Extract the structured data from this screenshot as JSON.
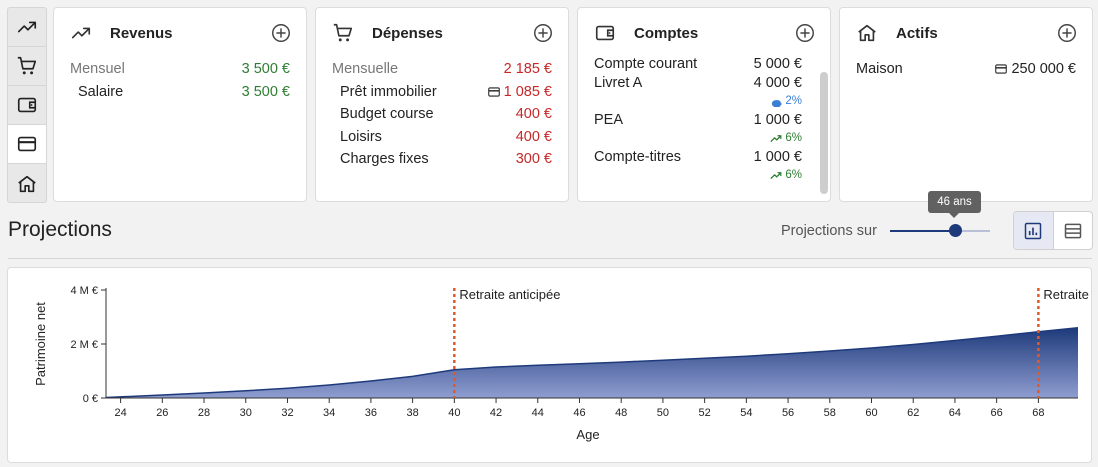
{
  "rail": {
    "items": [
      {
        "name": "trending-up-icon",
        "active": false
      },
      {
        "name": "cart-icon",
        "active": false
      },
      {
        "name": "wallet-icon",
        "active": false
      },
      {
        "name": "credit-card-icon",
        "active": true
      },
      {
        "name": "home-icon",
        "active": false
      }
    ]
  },
  "revenus": {
    "title": "Revenus",
    "group_label": "Mensuel",
    "group_amount": "3 500 €",
    "items": [
      {
        "label": "Salaire",
        "amount": "3 500 €"
      }
    ]
  },
  "depenses": {
    "title": "Dépenses",
    "group_label": "Mensuelle",
    "group_amount": "2 185 €",
    "items": [
      {
        "label": "Prêt immobilier",
        "amount": "1 085 €",
        "icon": "credit-card-icon"
      },
      {
        "label": "Budget course",
        "amount": "400 €"
      },
      {
        "label": "Loisirs",
        "amount": "400 €"
      },
      {
        "label": "Charges fixes",
        "amount": "300 €"
      }
    ]
  },
  "comptes": {
    "title": "Comptes",
    "items": [
      {
        "label": "Compte courant",
        "amount": "5 000 €",
        "rate": ""
      },
      {
        "label": "Livret A",
        "amount": "4 000 €",
        "rate": "2%",
        "rate_icon": "piggy-bank-icon"
      },
      {
        "label": "PEA",
        "amount": "1 000 €",
        "rate": "6%",
        "rate_icon": "trending-up-icon"
      },
      {
        "label": "Compte-titres",
        "amount": "1 000 €",
        "rate": "6%",
        "rate_icon": "trending-up-icon"
      }
    ]
  },
  "actifs": {
    "title": "Actifs",
    "items": [
      {
        "label": "Maison",
        "amount": "250 000 €",
        "icon": "credit-card-icon"
      }
    ]
  },
  "projections": {
    "title": "Projections",
    "slider_label": "Projections sur",
    "slider_tooltip": "46 ans",
    "slider_value": 46,
    "slider_fraction": 0.65,
    "view_modes": [
      {
        "name": "bar-chart-icon",
        "active": true
      },
      {
        "name": "table-icon",
        "active": false
      }
    ]
  },
  "colors": {
    "accent": "#1e3a7b",
    "green": "#2e7d32",
    "red": "#c62828",
    "annotation": "#e05a2b"
  },
  "chart_data": {
    "type": "area",
    "ylabel": "Patrimoine net",
    "xlabel": "Age",
    "x_ticks": [
      24,
      26,
      28,
      30,
      32,
      34,
      36,
      38,
      40,
      42,
      44,
      46,
      48,
      50,
      52,
      54,
      56,
      58,
      60,
      62,
      64,
      66,
      68
    ],
    "y_ticks": [
      {
        "value": 0,
        "label": "0 €"
      },
      {
        "value": 2000000,
        "label": "2 M €"
      },
      {
        "value": 4000000,
        "label": "4 M €"
      }
    ],
    "xlim": [
      23.3,
      69.9
    ],
    "ylim": [
      0,
      4000000
    ],
    "x": [
      23.3,
      26,
      28,
      30,
      32,
      34,
      36,
      38,
      40,
      42,
      44,
      46,
      48,
      50,
      52,
      54,
      56,
      58,
      60,
      62,
      64,
      66,
      68,
      69.9
    ],
    "y": [
      20000,
      110000,
      185000,
      265000,
      360000,
      480000,
      630000,
      800000,
      1050000,
      1150000,
      1210000,
      1270000,
      1330000,
      1400000,
      1470000,
      1550000,
      1640000,
      1740000,
      1850000,
      1980000,
      2130000,
      2290000,
      2450000,
      2600000
    ],
    "annotations": [
      {
        "x": 40,
        "label": "Retraite anticipée"
      },
      {
        "x": 68,
        "label": "Retraite"
      }
    ],
    "grid": false,
    "legend": "none"
  }
}
